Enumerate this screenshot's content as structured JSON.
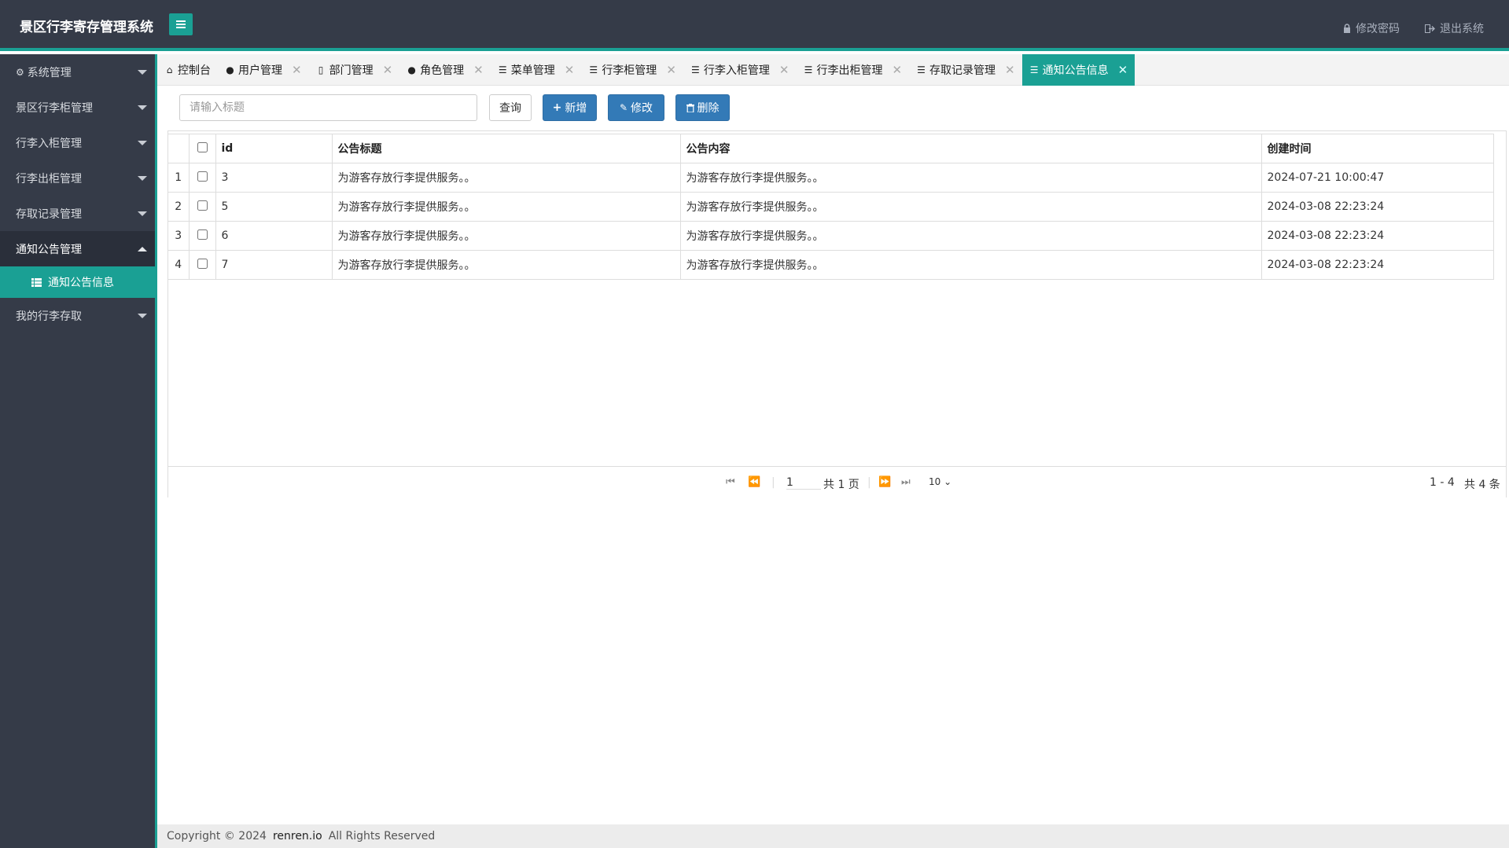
{
  "header": {
    "title": "景区行李寄存管理系统",
    "change_password": "修改密码",
    "logout": "退出系统"
  },
  "sidebar": {
    "items": [
      {
        "label": "系统管理"
      },
      {
        "label": "景区行李柜管理"
      },
      {
        "label": "行李入柜管理"
      },
      {
        "label": "行李出柜管理"
      },
      {
        "label": "存取记录管理"
      },
      {
        "label": "通知公告管理"
      },
      {
        "label": "我的行李存取"
      }
    ],
    "sub_item": "通知公告信息"
  },
  "tabs": [
    {
      "label": "控制台"
    },
    {
      "label": "用户管理"
    },
    {
      "label": "部门管理"
    },
    {
      "label": "角色管理"
    },
    {
      "label": "菜单管理"
    },
    {
      "label": "行李柜管理"
    },
    {
      "label": "行李入柜管理"
    },
    {
      "label": "行李出柜管理"
    },
    {
      "label": "存取记录管理"
    },
    {
      "label": "通知公告信息"
    }
  ],
  "toolbar": {
    "search_placeholder": "请输入标题",
    "query": "查询",
    "add": "新增",
    "edit": "修改",
    "delete": "删除"
  },
  "table": {
    "columns": [
      "id",
      "公告标题",
      "公告内容",
      "创建时间"
    ],
    "rows": [
      {
        "num": "1",
        "id": "3",
        "title": "为游客存放行李提供服务。。",
        "content": "为游客存放行李提供服务。。",
        "created": "2024-07-21 10:00:47"
      },
      {
        "num": "2",
        "id": "5",
        "title": "为游客存放行李提供服务。。",
        "content": "为游客存放行李提供服务。。",
        "created": "2024-03-08 22:23:24"
      },
      {
        "num": "3",
        "id": "6",
        "title": "为游客存放行李提供服务。。",
        "content": "为游客存放行李提供服务。。",
        "created": "2024-03-08 22:23:24"
      },
      {
        "num": "4",
        "id": "7",
        "title": "为游客存放行李提供服务。。",
        "content": "为游客存放行李提供服务。。",
        "created": "2024-03-08 22:23:24"
      }
    ]
  },
  "pager": {
    "page": "1",
    "total_pages": "共 1 页",
    "page_size": "10",
    "range": "1 - 4",
    "total": "共 4 条"
  },
  "footer": {
    "copyright": "Copyright © 2024",
    "brand": "renren.io",
    "rights": "All Rights Reserved"
  },
  "colors": {
    "accent": "#1aa094",
    "sidebar_bg": "#353b48",
    "primary_button": "#337ab7"
  }
}
